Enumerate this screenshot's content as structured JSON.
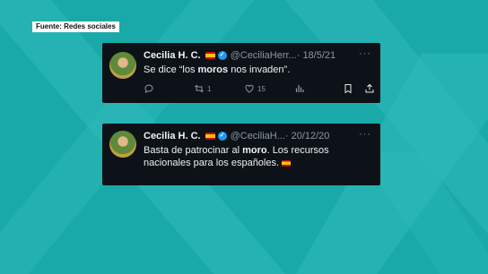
{
  "source": {
    "label": "Fuente: Redes sociales"
  },
  "tweets": [
    {
      "name": "Cecilia H. C.",
      "handle": "@CeciliaHerr...",
      "date": "· 18/5/21",
      "more": "···",
      "text_parts": [
        "Se dice “los ",
        "moros",
        " nos invaden”."
      ],
      "retweets": "1",
      "likes": "15"
    },
    {
      "name": "Cecilia H. C.",
      "handle": "@CeciliaH...",
      "date": "· 20/12/20",
      "more": "···",
      "text_parts": [
        "Basta de patrocinar al ",
        "moro",
        ". Los recursos nacionales para los españoles. "
      ]
    }
  ],
  "colors": {
    "background": "#1aa9a9",
    "card": "#0d1218",
    "verified": "#1d9bf0"
  },
  "icons": [
    "verified-icon",
    "flag-spain-icon",
    "reply-icon",
    "retweet-icon",
    "like-icon",
    "views-icon",
    "bookmark-icon",
    "share-icon"
  ]
}
